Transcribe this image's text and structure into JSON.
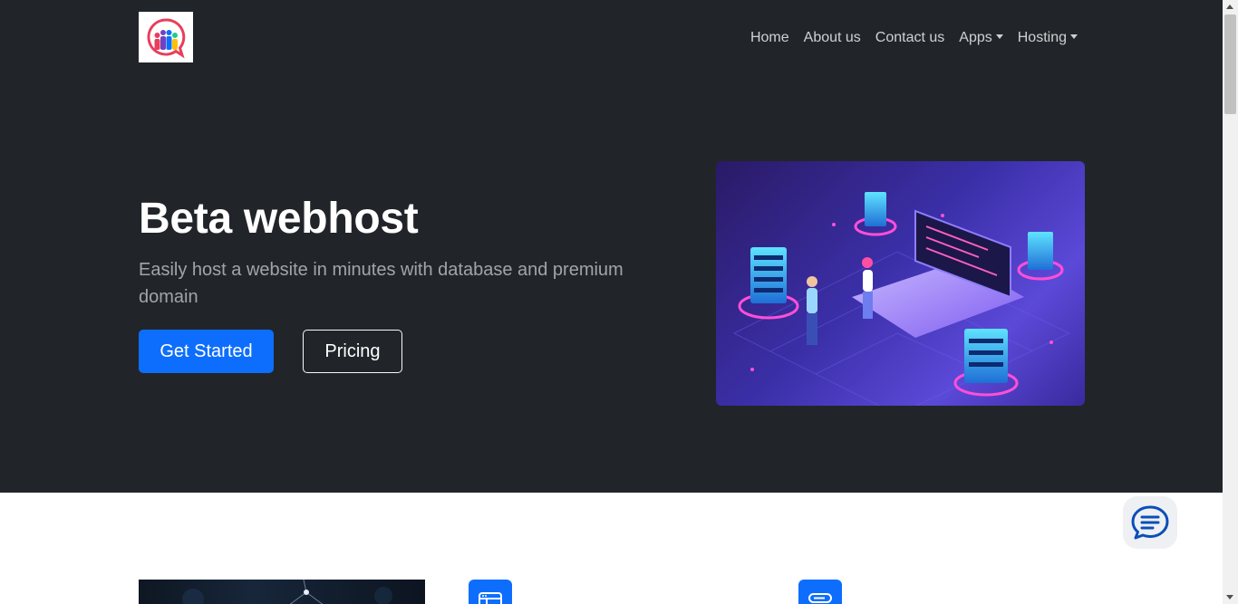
{
  "navbar": {
    "logo_icon": "community-chat-logo",
    "links": [
      {
        "label": "Home",
        "dropdown": false
      },
      {
        "label": "About us",
        "dropdown": false
      },
      {
        "label": "Contact us",
        "dropdown": false
      },
      {
        "label": "Apps",
        "dropdown": true
      },
      {
        "label": "Hosting",
        "dropdown": true
      }
    ]
  },
  "hero": {
    "title": "Beta webhost",
    "lead": "Easily host a website in minutes with database and premium domain",
    "primary_button": "Get Started",
    "secondary_button": "Pricing",
    "image_icon": "isometric-server-illustration"
  },
  "chat_widget": {
    "icon": "chat-bubble-icon"
  },
  "features": {
    "icons": [
      "browser-window-icon",
      "server-icon"
    ]
  },
  "colors": {
    "hero_background": "#212529",
    "primary": "#0d6efd",
    "nav_text": "rgba(255,255,255,0.78)",
    "lead_text": "rgba(255,255,255,0.58)"
  }
}
